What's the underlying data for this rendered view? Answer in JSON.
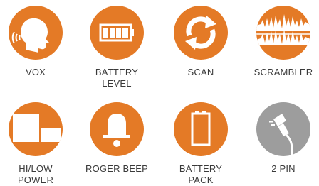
{
  "colors": {
    "orange": "#e47a26",
    "gray": "#9d9d9d",
    "text": "#3a3a3a"
  },
  "features": [
    {
      "line1": "VOX",
      "line2": "",
      "icon": "vox-head-icon"
    },
    {
      "line1": "BATTERY",
      "line2": "LEVEL",
      "icon": "battery-level-icon"
    },
    {
      "line1": "SCAN",
      "line2": "",
      "icon": "scan-arrows-icon"
    },
    {
      "line1": "SCRAMBLER",
      "line2": "",
      "icon": "scrambler-waveform-icon"
    },
    {
      "line1": "HI/LOW",
      "line2": "POWER",
      "icon": "hi-low-power-icon"
    },
    {
      "line1": "ROGER BEEP",
      "line2": "",
      "icon": "bell-icon"
    },
    {
      "line1": "BATTERY",
      "line2": "PACK",
      "icon": "battery-pack-icon"
    },
    {
      "line1": "2 PIN",
      "line2": "",
      "icon": "two-pin-plug-icon"
    }
  ]
}
